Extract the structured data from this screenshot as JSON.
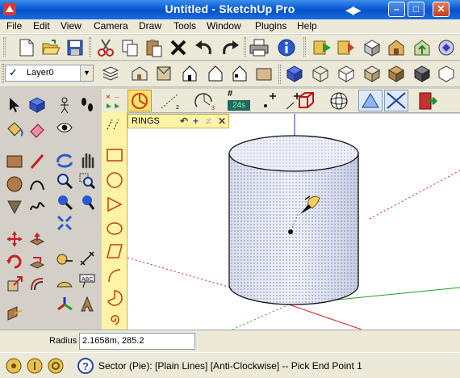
{
  "window": {
    "title": "Untitled - SketchUp Pro"
  },
  "menu": [
    "File",
    "Edit",
    "View",
    "Camera",
    "Draw",
    "Tools",
    "Window",
    "Plugins",
    "Help"
  ],
  "layers": {
    "current": "Layer0"
  },
  "toolbar": {
    "counter": "24s"
  },
  "rings_toolbar": {
    "title": "RINGS"
  },
  "measurements": {
    "label": "Radius",
    "value": "2.1658m, 285.2"
  },
  "status": {
    "message": "Sector (Pie): [Plain Lines]  [Anti-Clockwise] -- Pick End Point 1"
  },
  "colors": {
    "titlebar": "#0a5ad8",
    "drawbar": "#fff3a8",
    "axis_red": "#d02020",
    "axis_green": "#20a020",
    "axis_blue": "#2030c0"
  },
  "icons": [
    "sketchup-icon",
    "new-icon",
    "open-icon",
    "save-icon",
    "cut-icon",
    "copy-icon",
    "paste-icon",
    "erase-icon",
    "undo-icon",
    "redo-icon",
    "print-icon",
    "info-icon"
  ]
}
